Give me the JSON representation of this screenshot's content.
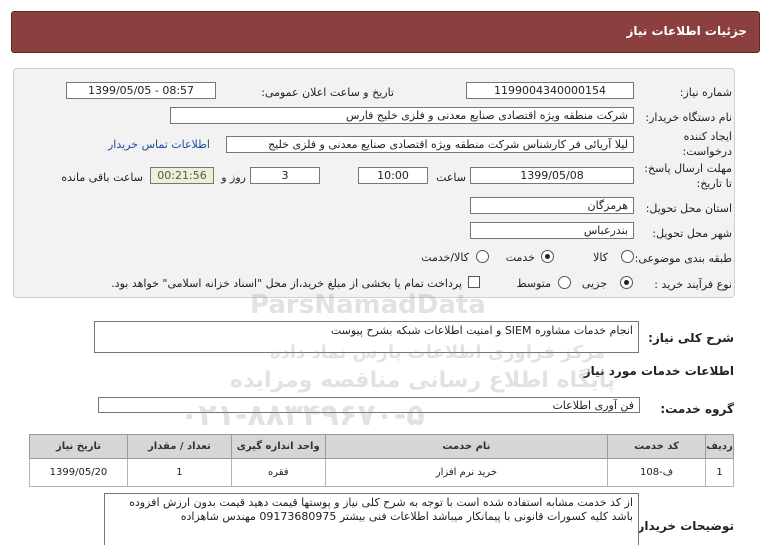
{
  "header": {
    "title": "جزئیات اطلاعات نیاز"
  },
  "details": {
    "need_number_label": "شماره نیاز:",
    "need_number": "1199004340000154",
    "announce_label": "تاریخ و ساعت اعلان عمومی:",
    "announce_value": "1399/05/05 - 08:57",
    "buyer_label": "نام دستگاه خریدار:",
    "buyer_value": "شرکت منطقه ویژه اقتصادی صنایع معدنی و فلزی خلیج فارس",
    "creator_label_1": "ایجاد کننده",
    "creator_label_2": "درخواست:",
    "creator_value": "لیلا آریائی فر کارشناس شرکت منطقه ویژه اقتصادی صنایع معدنی و فلزی خلیج",
    "contact_link": "اطلاعات تماس خریدار",
    "deadline_label_1": "مهلت ارسال پاسخ:",
    "deadline_label_2": "تا تاریخ:",
    "deadline_date": "1399/05/08",
    "time_label": "ساعت",
    "deadline_time": "10:00",
    "days_value": "3",
    "days_label": "روز و",
    "remaining_time": "00:21:56",
    "remaining_label": "ساعت باقی مانده",
    "province_label": "استان محل تحویل:",
    "province_value": "هرمزگان",
    "city_label": "شهر محل تحویل:",
    "city_value": "بندرعباس",
    "category_label": "طبقه بندی موضوعی:",
    "category_options": [
      "کالا",
      "خدمت",
      "کالا/خدمت"
    ],
    "category_selected": "خدمت",
    "process_label": "نوع فرآیند خرید :",
    "process_options": [
      "جزیی",
      "متوسط"
    ],
    "process_selected": "جزیی",
    "payment_note": "پرداخت تمام یا بخشی از مبلغ خرید،از محل \"اسناد خزانه اسلامی\" خواهد بود."
  },
  "summary": {
    "label": "شرح کلی نیاز:",
    "value": "انجام خدمات مشاوره SIEM و امنیت اطلاعات شبکه بشرح پیوست"
  },
  "services": {
    "section_title": "اطلاعات خدمات مورد نیاز",
    "group_label": "گروه خدمت:",
    "group_value": "فن آوری اطلاعات",
    "columns": [
      "ردیف",
      "کد خدمت",
      "نام خدمت",
      "واحد اندازه گیری",
      "تعداد / مقدار",
      "تاریخ نیاز"
    ],
    "rows": [
      {
        "index": "1",
        "code": "ف-108",
        "name": "خرید نرم افزار",
        "unit": "فقره",
        "qty": "1",
        "date": "1399/05/20"
      }
    ]
  },
  "buyer_notes": {
    "label": "توضیحات خریدار:",
    "value": "از کد خدمت مشابه استفاده شده است با توجه به شرح کلی نیاز و پوستها قیمت دهید قیمت بدون ارزش افزوده باشد کلیه کسورات قانونی با پیمانکار میباشد اطلاعات فنی بیشتر 09173680975 مهندس شاهزاده"
  },
  "watermark": {
    "brand": "ParsNamadData",
    "line1": "مرکز فراوری اطلاعات پارس نماد داده",
    "line2": "پایگاه اطلاع رسانی مناقصه ومزایده",
    "phone": "۰۲۱-۸۸۳۴۹۶۷۰-۵"
  }
}
